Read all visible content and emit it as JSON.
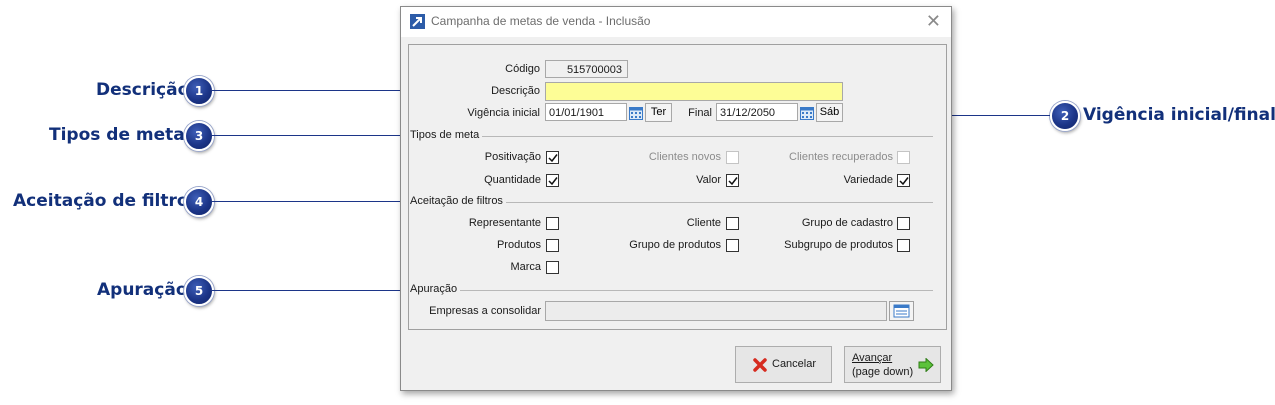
{
  "callouts": [
    {
      "number": "1",
      "label": "Descrição"
    },
    {
      "number": "2",
      "label": "Vigência inicial/final"
    },
    {
      "number": "3",
      "label": "Tipos de metas"
    },
    {
      "number": "4",
      "label": "Aceitação de filtros"
    },
    {
      "number": "5",
      "label": "Apuração"
    }
  ],
  "window": {
    "title": "Campanha de metas de venda - Inclusão",
    "close_glyph": "✕"
  },
  "form": {
    "codigo_label": "Código",
    "codigo_value": "515700003",
    "descricao_label": "Descrição",
    "descricao_value": "",
    "vig_inicial_label": "Vigência inicial",
    "vig_inicial_value": "01/01/1901",
    "vig_inicial_day": "Ter",
    "final_label": "Final",
    "final_value": "31/12/2050",
    "final_day": "Sáb"
  },
  "tipos_meta": {
    "title": "Tipos de meta",
    "items": [
      {
        "label": "Positivação",
        "checked": true,
        "enabled": true
      },
      {
        "label": "Clientes novos",
        "checked": false,
        "enabled": false
      },
      {
        "label": "Clientes recuperados",
        "checked": false,
        "enabled": false
      },
      {
        "label": "Quantidade",
        "checked": true,
        "enabled": true
      },
      {
        "label": "Valor",
        "checked": true,
        "enabled": true
      },
      {
        "label": "Variedade",
        "checked": true,
        "enabled": true
      }
    ]
  },
  "filtros": {
    "title": "Aceitação de filtros",
    "items": [
      {
        "label": "Representante",
        "checked": false
      },
      {
        "label": "Cliente",
        "checked": false
      },
      {
        "label": "Grupo de cadastro",
        "checked": false
      },
      {
        "label": "Produtos",
        "checked": false
      },
      {
        "label": "Grupo de produtos",
        "checked": false
      },
      {
        "label": "Subgrupo de produtos",
        "checked": false
      },
      {
        "label": "Marca",
        "checked": false
      }
    ]
  },
  "apuracao": {
    "title": "Apuração",
    "empresas_label": "Empresas a consolidar",
    "empresas_value": ""
  },
  "buttons": {
    "cancel": "Cancelar",
    "advance_line1": "Avançar",
    "advance_line2": "(page down)"
  },
  "colors": {
    "callout_blue": "#12307a",
    "descricao_bg": "#fdfd96",
    "window_bg": "#f0f0f0"
  }
}
